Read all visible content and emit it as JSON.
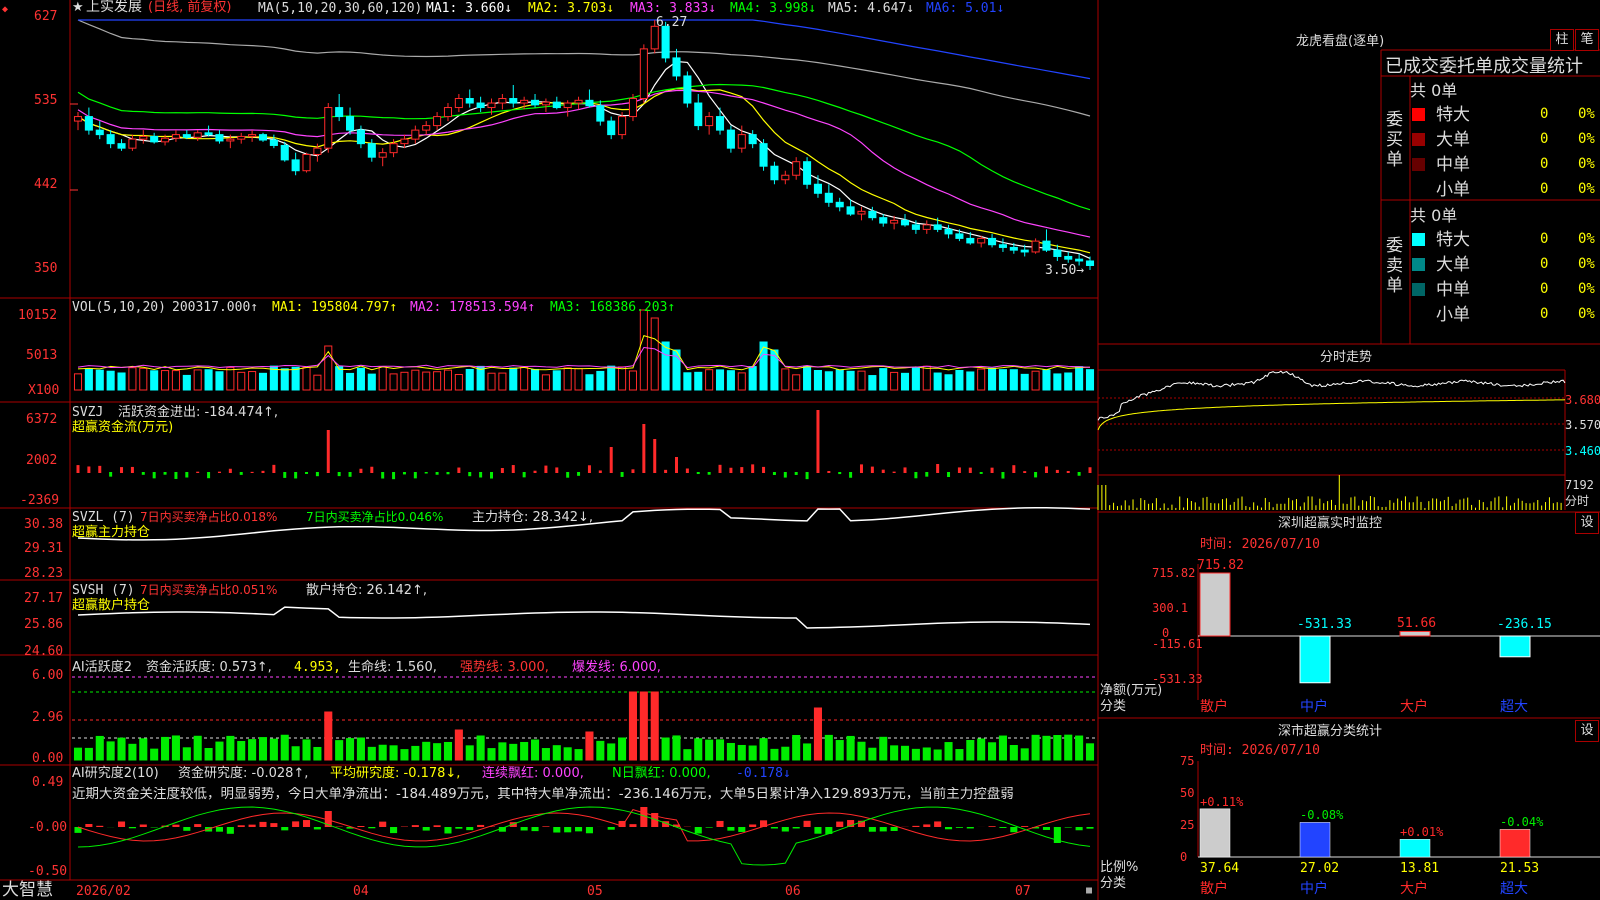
{
  "colors": {
    "up": "#ff2a2a",
    "down": "#00ffff",
    "frame": "#aa0000",
    "ma1": "#ffffff",
    "ma2": "#ffff00",
    "ma3": "#ff44ff",
    "ma4": "#00ff00",
    "ma5": "#aaaaaa",
    "ma6": "#2244ff",
    "green": "#00ee00"
  },
  "icons": {
    "star": "star-icon",
    "arrow": "arrow-icon",
    "lock": "lock-icon"
  },
  "main": {
    "header": {
      "marker": "◆",
      "star": "★",
      "stock": "上实发展",
      "period": "(日线, 前复权)",
      "ma_label": "MA(5,10,20,30,60,120)",
      "ma1": "MA1: 3.660↓",
      "ma2": "MA2: 3.703↓",
      "ma3": "MA3: 3.833↓",
      "ma4": "MA4: 3.998↓",
      "ma5": "MA5: 4.647↓",
      "ma6": "MA6: 5.01↓"
    },
    "high_label": "6.27",
    "low_label": "3.50→",
    "yaxis": [
      "627",
      "535",
      "442",
      "350"
    ]
  },
  "vol": {
    "header": {
      "name": "VOL(5,10,20)",
      "value": "200317.000↑",
      "ma1": "MA1: 195804.797↑",
      "ma2": "MA2: 178513.594↑",
      "ma3": "MA3: 168386.203↑"
    },
    "yaxis": [
      "10152",
      "5013",
      "X100"
    ]
  },
  "svzj": {
    "header": {
      "name": "SVZJ",
      "text": "活跃资金进出: -184.474↑,",
      "sub": "超赢资金流(万元)"
    },
    "yaxis": [
      "6372",
      "2002",
      "-2369"
    ]
  },
  "svzl": {
    "header": {
      "name": "SVZL (7)",
      "a": "7日内买卖净占比0.018%",
      "b": "7日内买卖净占比0.046%",
      "c": "主力持仓: 28.342↓,",
      "sub": "超赢主力持仓"
    },
    "yaxis": [
      "30.38",
      "29.31",
      "28.23"
    ]
  },
  "svsh": {
    "header": {
      "name": "SVSH (7)",
      "a": "7日内买卖净占比0.051%",
      "c": "散户持仓: 26.142↑,",
      "sub": "超赢散户持仓"
    },
    "yaxis": [
      "27.17",
      "25.86",
      "24.60"
    ]
  },
  "ai1": {
    "header": {
      "name": "AI活跃度2",
      "a": "资金活跃度: 0.573↑,",
      "b": "4.953,",
      "c": "生命线: 1.560,",
      "d": "强势线: 3.000,",
      "e": "爆发线: 6.000,"
    },
    "yaxis": [
      "6.00",
      "2.96",
      "0.00"
    ]
  },
  "ai2": {
    "header": {
      "name": "AI研究度2(10)",
      "a": "资金研究度: -0.028↑,",
      "b": "平均研究度: -0.178↓,",
      "c": "连续飘红: 0.000,",
      "d": "N日飘红: 0.000,",
      "e": "-0.178↓"
    },
    "desc": "近期大资金关注度较低，明显弱势，今日大单净流出：-184.489万元，其中特大单净流出：-236.146万元，大单5日累计净入129.893万元，当前主力控盘弱",
    "yaxis": [
      "0.49",
      "-0.00",
      "-0.50"
    ]
  },
  "bottom": {
    "brand": "大智慧",
    "dates": [
      "2026/02",
      "04",
      "05",
      "06",
      "07"
    ]
  },
  "dragon": {
    "title": "龙虎看盘(逐单)",
    "btn1": "柱",
    "btn2": "笔",
    "header": "已成交委托单成交量统计",
    "buy": {
      "side": "委买单",
      "total": "共 0单",
      "rows": [
        {
          "label": "特大",
          "value": "0",
          "pct": "0%",
          "color": "#ff0000"
        },
        {
          "label": "大单",
          "value": "0",
          "pct": "0%",
          "color": "#990000"
        },
        {
          "label": "中单",
          "value": "0",
          "pct": "0%",
          "color": "#660000"
        },
        {
          "label": "小单",
          "value": "0",
          "pct": "0%",
          "color": ""
        }
      ]
    },
    "sell": {
      "side": "委卖单",
      "total": "共 0单",
      "rows": [
        {
          "label": "特大",
          "value": "0",
          "pct": "0%",
          "color": "#00ffff"
        },
        {
          "label": "大单",
          "value": "0",
          "pct": "0%",
          "color": "#008888"
        },
        {
          "label": "中单",
          "value": "0",
          "pct": "0%",
          "color": "#006666"
        },
        {
          "label": "小单",
          "value": "0",
          "pct": "0%",
          "color": ""
        }
      ]
    }
  },
  "intraday": {
    "title": "分时走势",
    "yaxis": [
      "3.680",
      "3.570",
      "3.460"
    ],
    "vol_label": "7192",
    "vol_sub": "分时"
  },
  "monitor": {
    "title": "深圳超赢实时监控",
    "btn": "设",
    "time": "时间: 2026/07/10",
    "ylabels": [
      "715.82",
      "300.1",
      "0",
      "-115.61",
      "-531.33"
    ],
    "side": "净额(万元)",
    "side2": "分类"
  },
  "classify": {
    "title": "深市超赢分类统计",
    "btn": "设",
    "time": "时间: 2026/07/10",
    "ylabels": [
      "75",
      "50",
      "25",
      "0"
    ],
    "side": "比例%",
    "side2": "分类"
  },
  "chart_data": [
    {
      "type": "candlestick",
      "name": "上实发展",
      "xlabels": [
        "2026/02",
        "04",
        "05",
        "06",
        "07"
      ],
      "ylim": [
        3.5,
        6.27
      ],
      "ohlc": [
        [
          5.15,
          5.25,
          5.05,
          5.2
        ],
        [
          5.2,
          5.3,
          5.0,
          5.05
        ],
        [
          5.05,
          5.15,
          4.95,
          5.0
        ],
        [
          5.0,
          5.05,
          4.85,
          4.9
        ],
        [
          4.9,
          4.95,
          4.82,
          4.85
        ],
        [
          4.85,
          5.0,
          4.82,
          4.95
        ],
        [
          4.95,
          5.05,
          4.9,
          4.98
        ],
        [
          4.98,
          5.02,
          4.9,
          4.92
        ],
        [
          4.92,
          5.0,
          4.88,
          4.96
        ],
        [
          4.96,
          5.05,
          4.92,
          5.0
        ],
        [
          5.0,
          5.05,
          4.95,
          4.97
        ],
        [
          4.97,
          5.05,
          4.93,
          5.02
        ],
        [
          5.02,
          5.1,
          4.98,
          5.0
        ],
        [
          5.0,
          5.05,
          4.9,
          4.93
        ],
        [
          4.93,
          5.0,
          4.85,
          4.95
        ],
        [
          4.95,
          5.02,
          4.9,
          4.98
        ],
        [
          4.98,
          5.05,
          4.92,
          5.0
        ],
        [
          5.0,
          5.02,
          4.92,
          4.94
        ],
        [
          4.94,
          5.0,
          4.85,
          4.88
        ],
        [
          4.88,
          4.92,
          4.7,
          4.72
        ],
        [
          4.72,
          4.8,
          4.55,
          4.6
        ],
        [
          4.6,
          4.8,
          4.58,
          4.78
        ],
        [
          4.78,
          4.9,
          4.7,
          4.85
        ],
        [
          4.85,
          5.35,
          4.8,
          5.3
        ],
        [
          5.3,
          5.45,
          5.15,
          5.2
        ],
        [
          5.2,
          5.3,
          5.0,
          5.05
        ],
        [
          5.05,
          5.1,
          4.85,
          4.9
        ],
        [
          4.9,
          4.95,
          4.7,
          4.75
        ],
        [
          4.75,
          4.85,
          4.65,
          4.8
        ],
        [
          4.8,
          4.95,
          4.75,
          4.9
        ],
        [
          4.9,
          5.0,
          4.85,
          4.95
        ],
        [
          4.95,
          5.1,
          4.9,
          5.05
        ],
        [
          5.05,
          5.15,
          5.0,
          5.1
        ],
        [
          5.1,
          5.25,
          5.05,
          5.2
        ],
        [
          5.2,
          5.35,
          5.15,
          5.3
        ],
        [
          5.3,
          5.45,
          5.25,
          5.4
        ],
        [
          5.4,
          5.5,
          5.3,
          5.35
        ],
        [
          5.35,
          5.42,
          5.25,
          5.3
        ],
        [
          5.3,
          5.4,
          5.22,
          5.35
        ],
        [
          5.35,
          5.45,
          5.28,
          5.4
        ],
        [
          5.4,
          5.55,
          5.3,
          5.35
        ],
        [
          5.35,
          5.42,
          5.28,
          5.38
        ],
        [
          5.38,
          5.45,
          5.3,
          5.33
        ],
        [
          5.33,
          5.4,
          5.25,
          5.36
        ],
        [
          5.36,
          5.42,
          5.28,
          5.3
        ],
        [
          5.3,
          5.38,
          5.2,
          5.35
        ],
        [
          5.35,
          5.42,
          5.28,
          5.38
        ],
        [
          5.38,
          5.5,
          5.3,
          5.32
        ],
        [
          5.32,
          5.38,
          5.1,
          5.15
        ],
        [
          5.15,
          5.2,
          4.95,
          5.0
        ],
        [
          5.0,
          5.25,
          4.95,
          5.2
        ],
        [
          5.2,
          5.45,
          5.15,
          5.4
        ],
        [
          5.4,
          6.0,
          5.35,
          5.95
        ],
        [
          5.95,
          6.27,
          5.9,
          6.2
        ],
        [
          6.2,
          6.25,
          5.8,
          5.85
        ],
        [
          5.85,
          5.95,
          5.6,
          5.65
        ],
        [
          5.65,
          5.7,
          5.3,
          5.35
        ],
        [
          5.35,
          5.45,
          5.05,
          5.1
        ],
        [
          5.1,
          5.25,
          5.0,
          5.2
        ],
        [
          5.2,
          5.3,
          5.0,
          5.05
        ],
        [
          5.05,
          5.1,
          4.8,
          4.85
        ],
        [
          4.85,
          5.1,
          4.8,
          5.0
        ],
        [
          5.0,
          5.05,
          4.85,
          4.9
        ],
        [
          4.9,
          4.95,
          4.6,
          4.65
        ],
        [
          4.65,
          4.7,
          4.45,
          4.5
        ],
        [
          4.5,
          4.6,
          4.45,
          4.55
        ],
        [
          4.55,
          4.75,
          4.5,
          4.7
        ],
        [
          4.7,
          4.75,
          4.4,
          4.45
        ],
        [
          4.45,
          4.55,
          4.3,
          4.35
        ],
        [
          4.35,
          4.45,
          4.2,
          4.25
        ],
        [
          4.25,
          4.3,
          4.15,
          4.2
        ],
        [
          4.2,
          4.28,
          4.1,
          4.12
        ],
        [
          4.12,
          4.2,
          4.05,
          4.15
        ],
        [
          4.15,
          4.2,
          4.05,
          4.08
        ],
        [
          4.08,
          4.12,
          3.98,
          4.02
        ],
        [
          4.02,
          4.1,
          3.95,
          4.05
        ],
        [
          4.05,
          4.12,
          3.98,
          4.0
        ],
        [
          4.0,
          4.05,
          3.9,
          3.95
        ],
        [
          3.95,
          4.05,
          3.9,
          4.0
        ],
        [
          4.0,
          4.08,
          3.92,
          3.95
        ],
        [
          3.95,
          4.0,
          3.85,
          3.9
        ],
        [
          3.9,
          3.95,
          3.82,
          3.85
        ],
        [
          3.85,
          3.92,
          3.78,
          3.8
        ],
        [
          3.8,
          3.88,
          3.75,
          3.85
        ],
        [
          3.85,
          3.9,
          3.75,
          3.78
        ],
        [
          3.78,
          3.85,
          3.7,
          3.75
        ],
        [
          3.75,
          3.8,
          3.68,
          3.72
        ],
        [
          3.72,
          3.78,
          3.65,
          3.7
        ],
        [
          3.7,
          3.85,
          3.68,
          3.82
        ],
        [
          3.82,
          3.95,
          3.7,
          3.72
        ],
        [
          3.72,
          3.78,
          3.6,
          3.65
        ],
        [
          3.65,
          3.7,
          3.58,
          3.62
        ],
        [
          3.62,
          3.68,
          3.55,
          3.6
        ],
        [
          3.6,
          3.65,
          3.5,
          3.55
        ]
      ]
    },
    {
      "type": "bar",
      "name": "VOL",
      "ylim": [
        0,
        10152
      ],
      "series_note": "relative volume heights"
    },
    {
      "type": "bar",
      "name": "SVZJ",
      "ylim": [
        -2369,
        6372
      ]
    },
    {
      "type": "line",
      "name": "SVZL",
      "ylim": [
        28.23,
        30.38
      ]
    },
    {
      "type": "line",
      "name": "SVSH",
      "ylim": [
        24.6,
        27.17
      ]
    },
    {
      "type": "bar",
      "name": "AI活跃度2",
      "ylim": [
        0,
        6
      ]
    },
    {
      "type": "bar",
      "name": "AI研究度2",
      "ylim": [
        -0.5,
        0.49
      ]
    },
    {
      "type": "bar",
      "name": "深圳超赢实时监控",
      "categories": [
        "散户",
        "中户",
        "大户",
        "超大"
      ],
      "values": [
        715.82,
        -531.33,
        51.66,
        -236.15
      ],
      "ylim": [
        -531.33,
        715.82
      ]
    },
    {
      "type": "bar",
      "name": "深市超赢分类统计",
      "categories": [
        "散户",
        "中户",
        "大户",
        "超大"
      ],
      "values": [
        37.64,
        27.02,
        13.81,
        21.53
      ],
      "changes": [
        "+0.11%",
        "-0.08%",
        "+0.01%",
        "-0.04%"
      ],
      "ylim": [
        0,
        75
      ]
    }
  ]
}
